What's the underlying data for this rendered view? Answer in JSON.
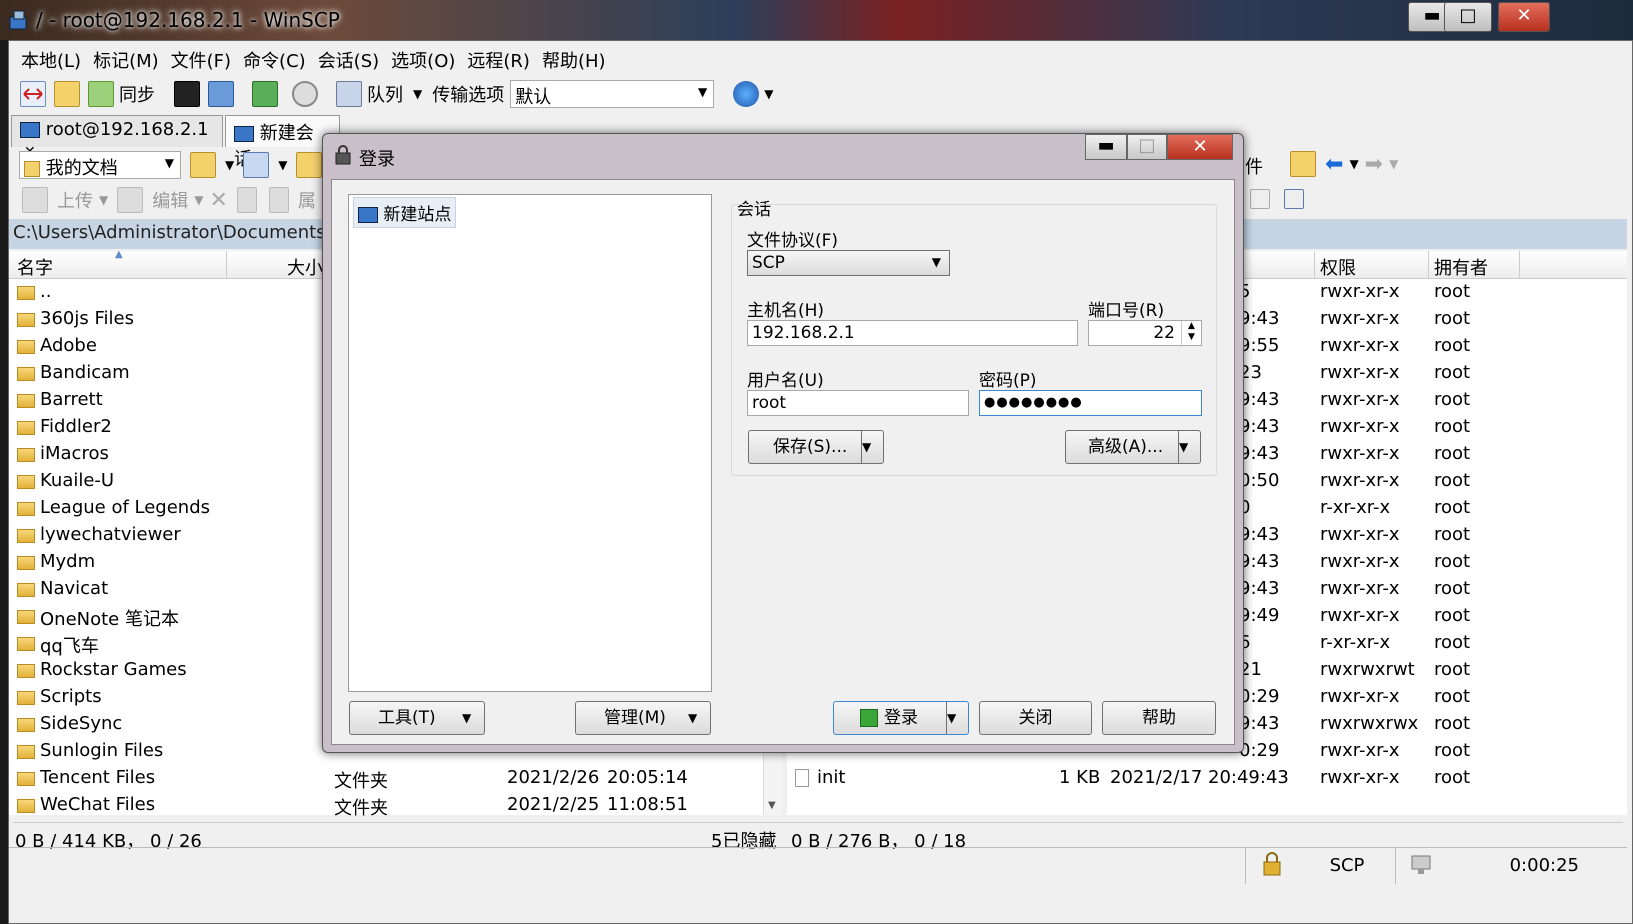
{
  "window": {
    "title": "/ - root@192.168.2.1 - WinSCP",
    "min": "▬",
    "max": "□",
    "close": "✕"
  },
  "menu": [
    "本地(L)",
    "标记(M)",
    "文件(F)",
    "命令(C)",
    "会话(S)",
    "选项(O)",
    "远程(R)",
    "帮助(H)"
  ],
  "toolbar": {
    "sync_label": "同步",
    "queue_label": "队列",
    "transfer_label": "传输选项",
    "transfer_value": "默认"
  },
  "tabs": [
    {
      "label": "root@192.168.2.1",
      "close": "✕"
    },
    {
      "label": "新建会话"
    }
  ],
  "local": {
    "location": "我的文档",
    "actions": {
      "upload": "上传",
      "edit": "编辑",
      "props": "属"
    },
    "path": "C:\\Users\\Administrator\\Documents\\",
    "columns": {
      "name": "名字",
      "size": "大小"
    },
    "rows": [
      {
        "name": ".."
      },
      {
        "name": "360js Files"
      },
      {
        "name": "Adobe"
      },
      {
        "name": "Bandicam"
      },
      {
        "name": "Barrett"
      },
      {
        "name": "Fiddler2"
      },
      {
        "name": "iMacros"
      },
      {
        "name": "Kuaile-U"
      },
      {
        "name": "League of Legends"
      },
      {
        "name": "lywechatviewer"
      },
      {
        "name": "Mydm"
      },
      {
        "name": "Navicat"
      },
      {
        "name": "OneNote 笔记本"
      },
      {
        "name": "qq飞车"
      },
      {
        "name": "Rockstar Games"
      },
      {
        "name": "Scripts"
      },
      {
        "name": "SideSync"
      },
      {
        "name": "Sunlogin Files"
      },
      {
        "name": "Tencent Files",
        "type": "文件夹",
        "date": "2021/2/26",
        "time": "20:05:14"
      },
      {
        "name": "WeChat Files",
        "type": "文件夹",
        "date": "2021/2/25",
        "time": "11:08:51"
      }
    ],
    "status": "0 B / 414 KB， 0 / 26",
    "hidden": "5已隐藏"
  },
  "remote": {
    "actions": {
      "file": "文件"
    },
    "columns": {
      "rights": "权限",
      "owner": "拥有者"
    },
    "rows": [
      {
        "frag": "5",
        "rights": "rwxr-xr-x",
        "owner": "root"
      },
      {
        "frag": "9:43",
        "rights": "rwxr-xr-x",
        "owner": "root"
      },
      {
        "frag": "9:55",
        "rights": "rwxr-xr-x",
        "owner": "root"
      },
      {
        "frag": "23",
        "rights": "rwxr-xr-x",
        "owner": "root"
      },
      {
        "frag": "9:43",
        "rights": "rwxr-xr-x",
        "owner": "root"
      },
      {
        "frag": "9:43",
        "rights": "rwxr-xr-x",
        "owner": "root"
      },
      {
        "frag": "9:43",
        "rights": "rwxr-xr-x",
        "owner": "root"
      },
      {
        "frag": "0:50",
        "rights": "rwxr-xr-x",
        "owner": "root"
      },
      {
        "frag": "0",
        "rights": "r-xr-xr-x",
        "owner": "root"
      },
      {
        "frag": "9:43",
        "rights": "rwxr-xr-x",
        "owner": "root"
      },
      {
        "frag": "9:43",
        "rights": "rwxr-xr-x",
        "owner": "root"
      },
      {
        "frag": "9:43",
        "rights": "rwxr-xr-x",
        "owner": "root"
      },
      {
        "frag": "9:49",
        "rights": "rwxr-xr-x",
        "owner": "root"
      },
      {
        "frag": "6",
        "rights": "r-xr-xr-x",
        "owner": "root"
      },
      {
        "frag": "21",
        "rights": "rwxrwxrwt",
        "owner": "root"
      },
      {
        "frag": "0:29",
        "rights": "rwxr-xr-x",
        "owner": "root"
      },
      {
        "frag": "9:43",
        "rights": "rwxrwxrwx",
        "owner": "root"
      },
      {
        "frag": "0:29",
        "rights": "rwxr-xr-x",
        "owner": "root"
      }
    ],
    "last_row": {
      "name": "init",
      "size": "1 KB",
      "date": "2021/2/17 20:49:43",
      "rights": "rwxr-xr-x",
      "owner": "root"
    },
    "status": "0 B / 276 B， 0 / 18"
  },
  "statusbar": {
    "protocol": "SCP",
    "time": "0:00:25"
  },
  "login": {
    "title": "登录",
    "site": "新建站点",
    "group_label": "会话",
    "protocol_label": "文件协议(F)",
    "protocol_value": "SCP",
    "host_label": "主机名(H)",
    "host_value": "192.168.2.1",
    "port_label": "端口号(R)",
    "port_value": "22",
    "user_label": "用户名(U)",
    "user_value": "root",
    "pass_label": "密码(P)",
    "pass_value": "●●●●●●●●",
    "save_btn": "保存(S)...",
    "advanced_btn": "高级(A)...",
    "tools_btn": "工具(T)",
    "manage_btn": "管理(M)",
    "login_btn": "登录",
    "close_btn": "关闭",
    "help_btn": "帮助"
  }
}
